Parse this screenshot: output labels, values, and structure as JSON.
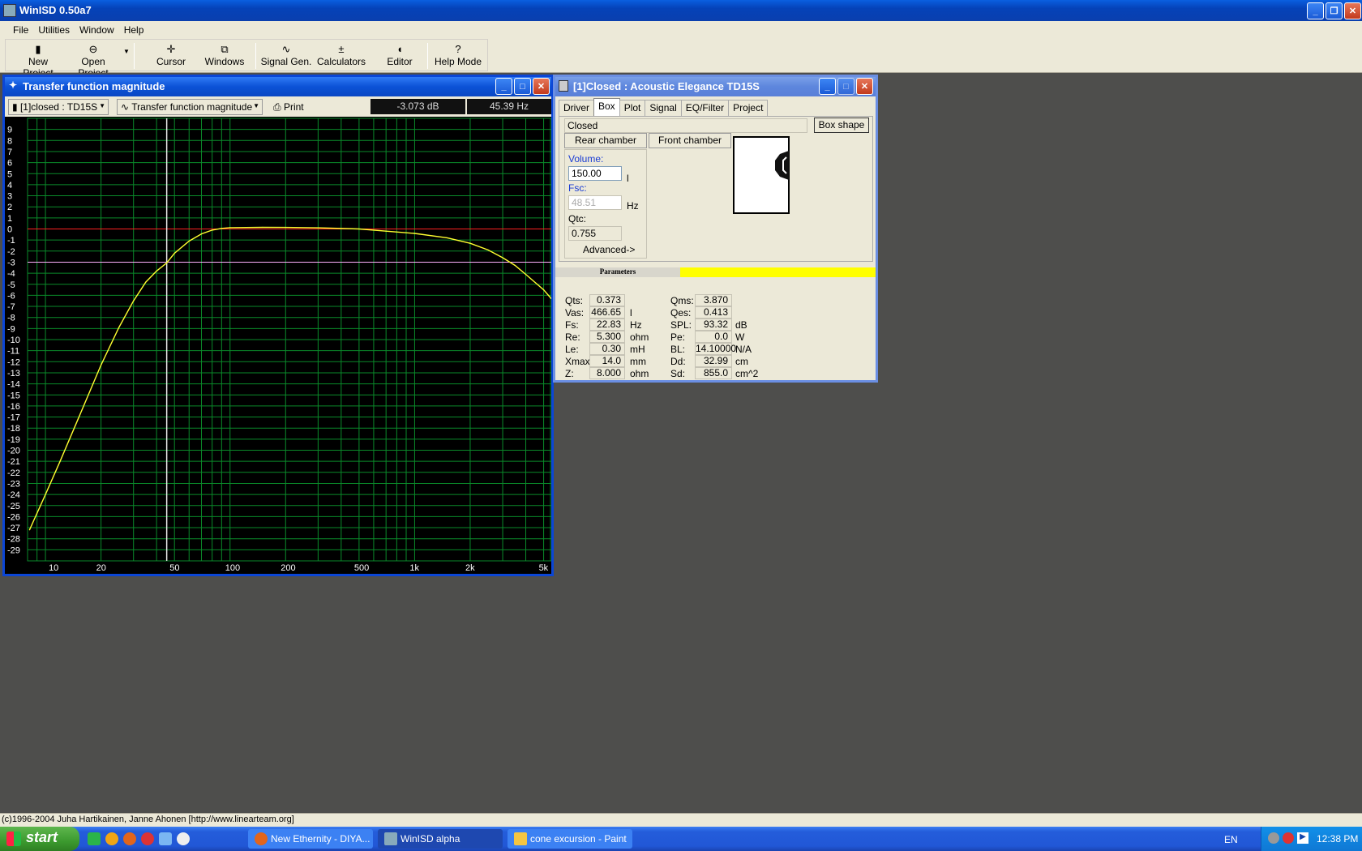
{
  "app": {
    "title": "WinISD 0.50a7"
  },
  "menu": [
    "File",
    "Utilities",
    "Window",
    "Help"
  ],
  "toolbar": {
    "new_project": "New Project",
    "open_project": "Open Project",
    "cursor": "Cursor",
    "windows": "Windows",
    "signal_gen": "Signal Gen.",
    "calculators": "Calculators",
    "editor": "Editor",
    "help_mode": "Help Mode"
  },
  "chart_window": {
    "title": "Transfer function magnitude",
    "project_select": "[1]closed : TD15S",
    "graph_select": "Transfer function magnitude",
    "print_label": "Print",
    "readout_db": "-3.073 dB",
    "readout_hz": "45.39 Hz"
  },
  "chart_data": {
    "type": "line",
    "title": "",
    "xlabel": "",
    "ylabel": "",
    "xscale": "log",
    "xlim": [
      8,
      5500
    ],
    "ylim": [
      -30,
      10
    ],
    "x_tick_labels": [
      "10",
      "20",
      "50",
      "100",
      "200",
      "500",
      "1k",
      "2k",
      "5k"
    ],
    "x_tick_values": [
      10,
      20,
      50,
      100,
      200,
      500,
      1000,
      2000,
      5000
    ],
    "y_ticks": [
      9,
      8,
      7,
      6,
      5,
      4,
      3,
      2,
      1,
      0,
      -1,
      -2,
      -3,
      -4,
      -5,
      -6,
      -7,
      -8,
      -9,
      -10,
      -11,
      -12,
      -13,
      -14,
      -15,
      -16,
      -17,
      -18,
      -19,
      -20,
      -21,
      -22,
      -23,
      -24,
      -25,
      -26,
      -27,
      -28,
      -29
    ],
    "grid": true,
    "reference_lines": [
      {
        "y": 0,
        "color": "#ff2020"
      },
      {
        "y": -3,
        "color": "#ffb0ff"
      }
    ],
    "cursor_x": 45.39,
    "series": [
      {
        "color": "#ffff30",
        "x": [
          8.2,
          10,
          12,
          15,
          20,
          25,
          30,
          35,
          40,
          45.39,
          50,
          60,
          70,
          80,
          90,
          100,
          150,
          200,
          300,
          500,
          700,
          1000,
          1500,
          2000,
          2500,
          3000,
          3500,
          4000,
          5000,
          5500
        ],
        "y": [
          -27.2,
          -24,
          -21,
          -17.2,
          -12.3,
          -8.9,
          -6.5,
          -4.8,
          -3.8,
          -3.07,
          -2.2,
          -1.1,
          -0.45,
          -0.1,
          0.05,
          0.12,
          0.15,
          0.14,
          0.1,
          0.0,
          -0.2,
          -0.4,
          -0.8,
          -1.3,
          -1.9,
          -2.6,
          -3.3,
          -4.1,
          -5.5,
          -6.3
        ]
      }
    ]
  },
  "box_window": {
    "title": "[1]Closed : Acoustic Elegance TD15S",
    "tabs": [
      "Driver",
      "Box",
      "Plot",
      "Signal",
      "EQ/Filter",
      "Project"
    ],
    "active_tab": "Box",
    "box_type": "Closed",
    "box_shape_btn": "Box shape",
    "rear_chamber": "Rear chamber",
    "front_chamber": "Front chamber",
    "volume_label": "Volume:",
    "volume_value": "150.00",
    "volume_unit": "l",
    "fsc_label": "Fsc:",
    "fsc_value": "48.51",
    "fsc_unit": "Hz",
    "qtc_label": "Qtc:",
    "qtc_value": "0.755",
    "advanced": "Advanced->",
    "params_header": "Parameters"
  },
  "params": {
    "left": [
      {
        "label": "Qts:",
        "value": "0.373",
        "unit": ""
      },
      {
        "label": "Vas:",
        "value": "466.65",
        "unit": "l"
      },
      {
        "label": "Fs:",
        "value": "22.83",
        "unit": "Hz"
      },
      {
        "label": "Re:",
        "value": "5.300",
        "unit": "ohm"
      },
      {
        "label": "Le:",
        "value": "0.30",
        "unit": "mH"
      },
      {
        "label": "Xmax:",
        "value": "14.0",
        "unit": "mm"
      },
      {
        "label": "Z:",
        "value": "8.000",
        "unit": "ohm"
      }
    ],
    "right": [
      {
        "label": "Qms:",
        "value": "3.870",
        "unit": ""
      },
      {
        "label": "Qes:",
        "value": "0.413",
        "unit": ""
      },
      {
        "label": "SPL:",
        "value": "93.32",
        "unit": "dB"
      },
      {
        "label": "Pe:",
        "value": "0.0",
        "unit": "W"
      },
      {
        "label": "BL:",
        "value": "14.10000",
        "unit": "N/A"
      },
      {
        "label": "Dd:",
        "value": "32.99",
        "unit": "cm"
      },
      {
        "label": "Sd:",
        "value": "855.0",
        "unit": "cm^2"
      }
    ]
  },
  "status": {
    "text": "(c)1996-2004 Juha Hartikainen, Janne Ahonen [http://www.linearteam.org]"
  },
  "taskbar": {
    "start": "start",
    "tasks": [
      "New Ethernity - DIYA...",
      "WinISD alpha",
      "cone excursion - Paint"
    ],
    "lang": "EN",
    "clock": "12:38 PM"
  },
  "colors": {
    "plot_bg": "#000000",
    "grid": "#0a8a2a",
    "accent": "#0a4ad0"
  }
}
